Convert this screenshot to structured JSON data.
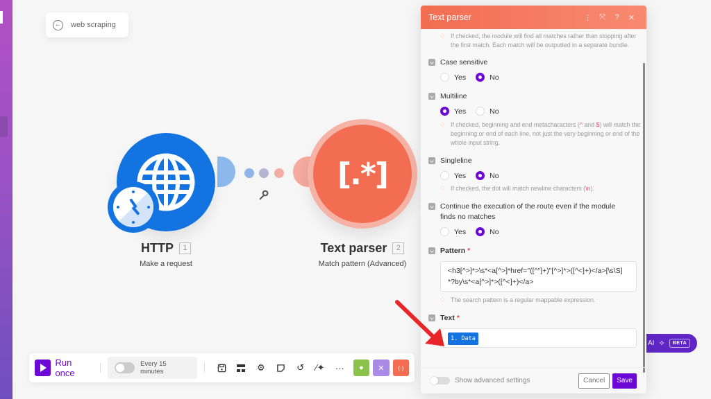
{
  "scenario": {
    "name": "web scraping",
    "back_icon": "arrow-left-circle-icon"
  },
  "modules": [
    {
      "name": "HTTP",
      "number": "1",
      "subtitle": "Make a request",
      "icon": "globe-icon",
      "badge_icon": "clock-icon",
      "color": "#1373e0"
    },
    {
      "name": "Text parser",
      "number": "2",
      "subtitle": "Match pattern (Advanced)",
      "icon_text": "(.*)",
      "icon_glyph": "[.*]",
      "color": "#f26d52"
    }
  ],
  "route": {
    "dot_colors": [
      "#8fb4ea",
      "#b4b6cf",
      "#f2aea2"
    ],
    "filter_icon": "wrench-icon"
  },
  "toolbar": {
    "run_label": "Run once",
    "schedule_label": "Every 15 minutes",
    "schedule_enabled": false,
    "icons": [
      "save-icon",
      "flow-control-icon",
      "settings-icon",
      "notes-icon",
      "undo-icon",
      "auto-align-icon",
      "more-icon"
    ],
    "quick_buttons": [
      {
        "name": "tools",
        "color": "#8bc34a",
        "glyph": "●"
      },
      {
        "name": "flow-control",
        "color": "#a98ae6",
        "glyph": "✕"
      },
      {
        "name": "text-parser",
        "color": "#f26d52",
        "glyph": "(·)"
      }
    ]
  },
  "ai_assistant": {
    "label": "AI",
    "badge": "BETA",
    "color": "#5f26c5"
  },
  "panel": {
    "title": "Text parser",
    "header_icons": [
      "more-vertical-icon",
      "maximize-icon",
      "help-icon",
      "close-icon"
    ],
    "header_glyphs": [
      "⋮",
      "⤧",
      "?",
      "✕"
    ],
    "top_hint": "If checked, the module will find all matches rather than stopping after the first match. Each match will be outputted in a separate bundle.",
    "fields": {
      "case_sensitive": {
        "label": "Case sensitive",
        "options": [
          "Yes",
          "No"
        ],
        "selected": "No"
      },
      "multiline": {
        "label": "Multiline",
        "options": [
          "Yes",
          "No"
        ],
        "selected": "Yes",
        "hint_pre": "If checked, beginning and end metacharacters (",
        "hint_caret": "^",
        "hint_and": " and ",
        "hint_dollar": "$",
        "hint_post": ") will match the beginning or end of each line, not just the very beginning or end of the whole input string."
      },
      "singleline": {
        "label": "Singleline",
        "options": [
          "Yes",
          "No"
        ],
        "selected": "No",
        "hint_pre": "If checked, the dot will match newline characters (",
        "hint_code": "\\n",
        "hint_post": ")."
      },
      "continue": {
        "label": "Continue the execution of the route even if the module finds no matches",
        "options": [
          "Yes",
          "No"
        ],
        "selected": "No"
      },
      "pattern": {
        "label": "Pattern",
        "required_mark": "*",
        "value": "<h3[^>]*>\\s*<a[^>]*href=\"([^\"]+)\"[^>]*>([^<]+)</a>[\\s\\S]*?by\\s*<a[^>]*>([^<]+)</a>",
        "hint": "The search pattern is a regular mappable expression."
      },
      "text": {
        "label": "Text",
        "required_mark": "*",
        "mapped_value": "1. Data"
      }
    },
    "footer": {
      "advanced_label": "Show advanced settings",
      "advanced_enabled": false,
      "cancel_label": "Cancel",
      "save_label": "Save"
    }
  }
}
